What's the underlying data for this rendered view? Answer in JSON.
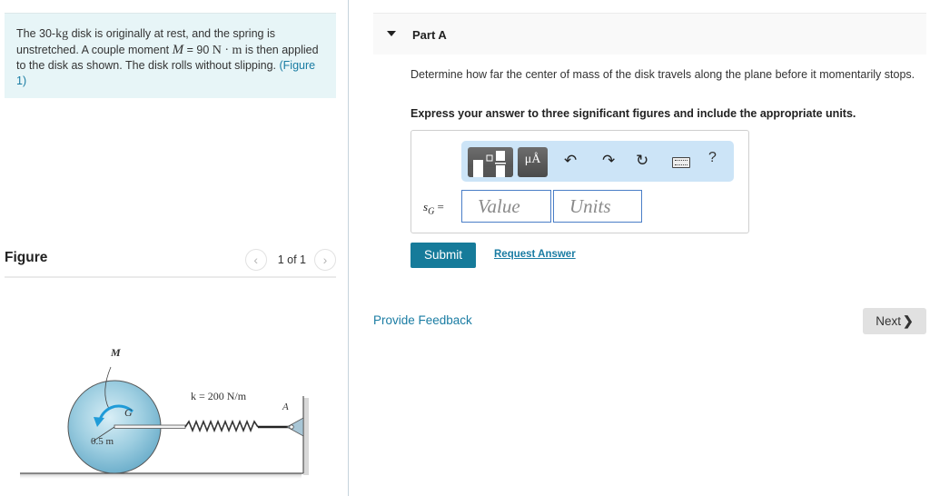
{
  "problem": {
    "t1": "The 30-",
    "mass_unit": "kg",
    "t2": " disk is originally at rest, and the spring is unstretched. A couple moment ",
    "moment_symbol": "M",
    "t3": " = 90 ",
    "moment_unit": "N · m",
    "t4": " is then applied to the disk as shown. The disk rolls without slipping. ",
    "figure_link": "(Figure 1)"
  },
  "figure_panel": {
    "title": "Figure",
    "pager_text": "1 of 1",
    "prev_icon": "chevron-left",
    "next_icon": "chevron-right"
  },
  "figure": {
    "moment_label": "M",
    "center_label": "G",
    "spring_label": "k = 200 N/m",
    "anchor_label": "A",
    "radius_label": "0.5 m"
  },
  "part": {
    "title": "Part A",
    "question": "Determine how far the center of mass of the disk travels along the plane before it momentarily stops.",
    "instruction": "Express your answer to three significant figures and include the appropriate units."
  },
  "answer": {
    "variable": "s",
    "subscript": "G",
    "equals": " =",
    "value_placeholder": "Value",
    "units_placeholder": "Units",
    "toolbar": {
      "templates_icon": "templates-icon",
      "units_label": "μÅ",
      "undo_icon": "↶",
      "redo_icon": "↷",
      "reset_icon": "↻",
      "keyboard_icon": "keyboard-icon",
      "help_label": "?"
    }
  },
  "actions": {
    "submit": "Submit",
    "request_answer": "Request Answer",
    "provide_feedback": "Provide Feedback",
    "next": "Next",
    "next_glyph": "❯"
  }
}
